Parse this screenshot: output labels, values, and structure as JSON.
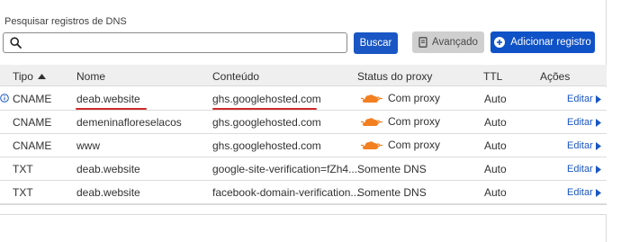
{
  "search": {
    "label": "Pesquisar registros de DNS",
    "value": "",
    "placeholder": ""
  },
  "buttons": {
    "search": "Buscar",
    "advanced": "Avançado",
    "add": "Adicionar registro"
  },
  "columns": {
    "type": "Tipo",
    "name": "Nome",
    "content": "Conteúdo",
    "proxy_status": "Status do proxy",
    "ttl": "TTL",
    "actions": "Ações"
  },
  "records": [
    {
      "type": "CNAME",
      "name": "deab.website",
      "content": "ghs.googlehosted.com",
      "proxy": "Com proxy",
      "ttl": "Auto",
      "action": "Editar"
    },
    {
      "type": "CNAME",
      "name": "demeninafloreselacos",
      "content": "ghs.googlehosted.com",
      "proxy": "Com proxy",
      "ttl": "Auto",
      "action": "Editar"
    },
    {
      "type": "CNAME",
      "name": "www",
      "content": "ghs.googlehosted.com",
      "proxy": "Com proxy",
      "ttl": "Auto",
      "action": "Editar"
    },
    {
      "type": "TXT",
      "name": "deab.website",
      "content": "google-site-verification=fZh4...",
      "proxy": "Somente DNS",
      "ttl": "Auto",
      "action": "Editar"
    },
    {
      "type": "TXT",
      "name": "deab.website",
      "content": "facebook-domain-verification...",
      "proxy": "Somente DNS",
      "ttl": "Auto",
      "action": "Editar"
    }
  ],
  "colors": {
    "primary": "#0f51c7",
    "cloud_orange": "#f38020",
    "annotation_red": "#d12a2a"
  }
}
